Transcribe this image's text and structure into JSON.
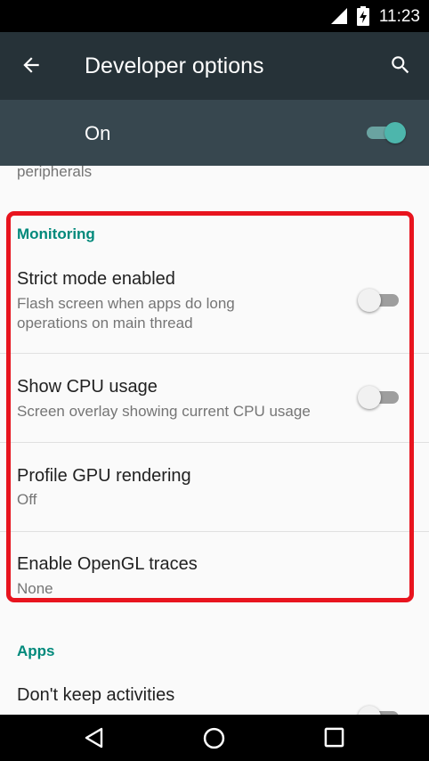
{
  "status_bar": {
    "time": "11:23",
    "signal_icon": "signal-icon",
    "battery_icon": "battery-charging-icon"
  },
  "app_bar": {
    "title": "Developer options",
    "back_icon": "back-arrow-icon",
    "search_icon": "search-icon"
  },
  "master_switch": {
    "label": "On",
    "state": "on"
  },
  "partial_item": {
    "text": "peripherals"
  },
  "monitoring": {
    "header": "Monitoring",
    "items": [
      {
        "title": "Strict mode enabled",
        "summary_line1": "Flash screen when apps do long",
        "summary_line2": "operations on main thread",
        "switch": "off"
      },
      {
        "title": "Show CPU usage",
        "summary": "Screen overlay showing current CPU usage",
        "switch": "off"
      },
      {
        "title": "Profile GPU rendering",
        "summary": "Off"
      },
      {
        "title": "Enable OpenGL traces",
        "summary": "None"
      }
    ]
  },
  "apps": {
    "header": "Apps",
    "items": [
      {
        "title": "Don't keep activities",
        "switch": "off"
      }
    ]
  },
  "nav_bar": {
    "back_icon": "nav-back-icon",
    "home_icon": "nav-home-icon",
    "recents_icon": "nav-recents-icon"
  },
  "colors": {
    "accent": "#009688",
    "app_bar": "#263238",
    "highlight": "#e8141e"
  }
}
